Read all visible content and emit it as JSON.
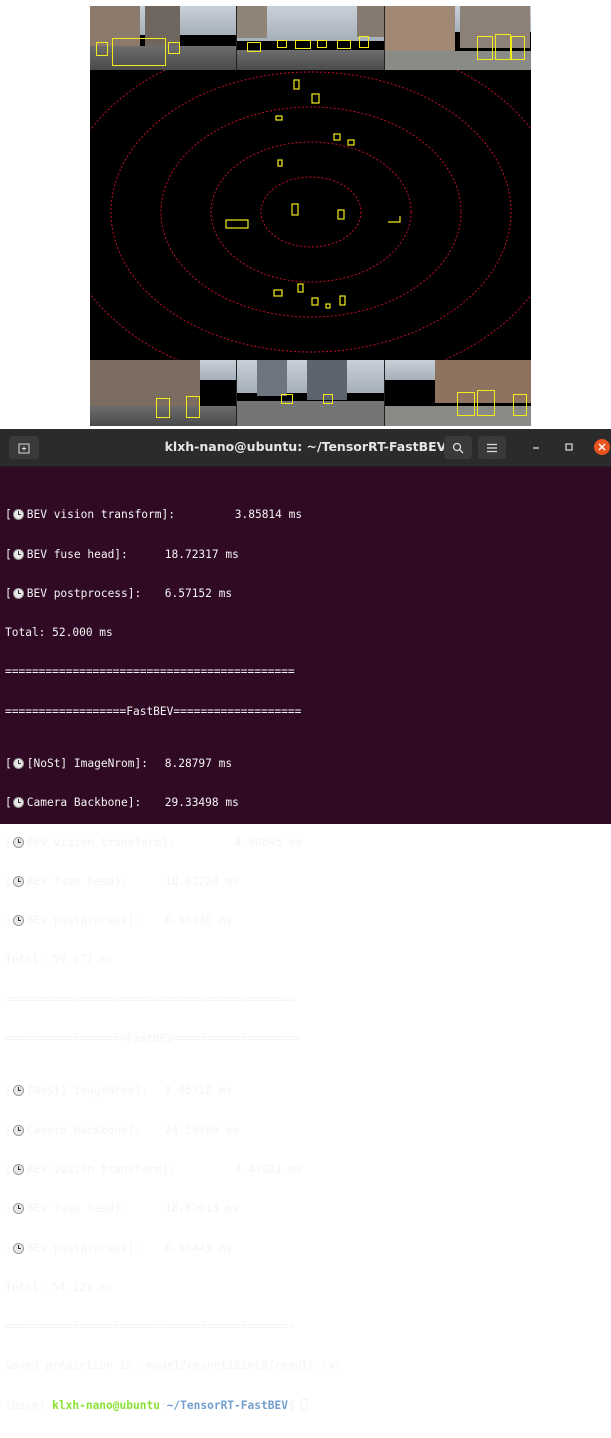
{
  "window": {
    "title": "klxh-nano@ubuntu: ~/TensorRT-FastBEV",
    "icons": {
      "new_tab": "new-terminal-icon",
      "search": "search-icon",
      "menu": "hamburger-menu-icon",
      "minimize": "minimize-icon",
      "maximize": "maximize-icon",
      "close": "close-icon"
    }
  },
  "terminal": {
    "block0": [
      {
        "label": "BEV vision transform]:",
        "value": "3.85814 ms"
      },
      {
        "label": "BEV fuse head]:",
        "value": "18.72317 ms"
      },
      {
        "label": "BEV postprocess]:",
        "value": "6.57152 ms"
      }
    ],
    "total0": "Total: 52.000 ms",
    "separator": "===========================================",
    "header": "==================FastBEV===================",
    "block1": [
      {
        "label": "[NoSt] ImageNrom]:",
        "value": "8.28797 ms"
      },
      {
        "label": "Camera Backbone]:",
        "value": "29.33498 ms"
      },
      {
        "label": "BEV vision transform]:",
        "value": "4.68845 ms"
      },
      {
        "label": "BEV fuse head]:",
        "value": "18.82224 ms"
      },
      {
        "label": "BEV postprocess]:",
        "value": "6.53146 ms"
      }
    ],
    "total1": "Total: 59.377 ms",
    "block2": [
      {
        "label": "[NoSt] ImageNrom]:",
        "value": "9.05718 ms"
      },
      {
        "label": "Camera Backbone]:",
        "value": "24.29789 ms"
      },
      {
        "label": "BEV vision transform]:",
        "value": "4.47021 ms"
      },
      {
        "label": "BEV fuse head]:",
        "value": "18.82013 ms"
      },
      {
        "label": "BEV postprocess]:",
        "value": "6.53443 ms"
      }
    ],
    "total2": "Total: 54.123 ms",
    "saved": "Saved prediction in: model/resnet18int8/result.txt",
    "prompt": {
      "env": "(base) ",
      "user": "klxh-nano@ubuntu",
      "sep": ":",
      "path": "~/TensorRT-FastBEV",
      "suffix": "$ "
    }
  },
  "colors": {
    "terminal_bg": "#300a24",
    "titlebar_bg": "#2b2b2b",
    "box": "#f2ec1a",
    "ring": "#c0102a",
    "prompt_user": "#8ae234",
    "prompt_path": "#729fcf",
    "close": "#e95420"
  }
}
